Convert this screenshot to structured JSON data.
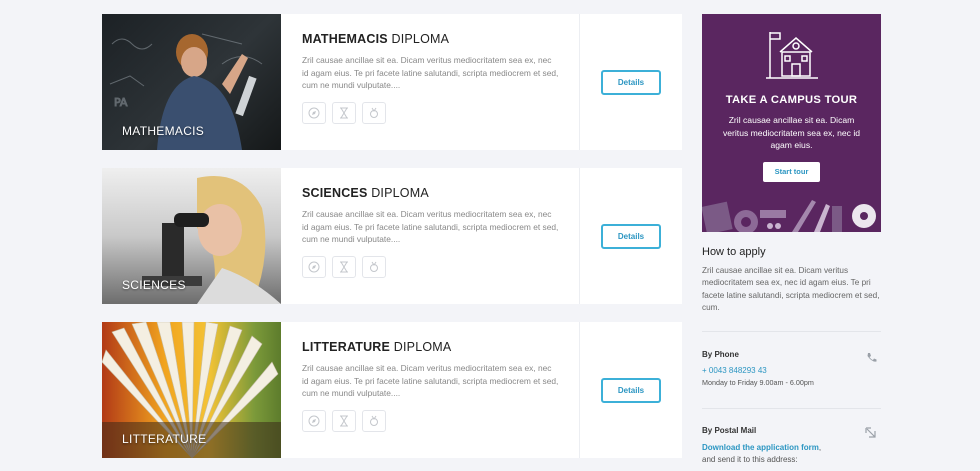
{
  "courses": [
    {
      "caption": "MATHEMACIS",
      "title_bold": "MATHEMACIS",
      "title_rest": "DIPLOMA",
      "description": "Zril causae ancillae sit ea. Dicam veritus mediocritatem sea ex, nec id agam eius. Te pri facete latine salutandi, scripta mediocrem et sed, cum ne mundi vulputate....",
      "button": "Details"
    },
    {
      "caption": "SCIENCES",
      "title_bold": "SCIENCES",
      "title_rest": "DIPLOMA",
      "description": "Zril causae ancillae sit ea. Dicam veritus mediocritatem sea ex, nec id agam eius. Te pri facete latine salutandi, scripta mediocrem et sed, cum ne mundi vulputate....",
      "button": "Details"
    },
    {
      "caption": "LITTERATURE",
      "title_bold": "LITTERATURE",
      "title_rest": "DIPLOMA",
      "description": "Zril causae ancillae sit ea. Dicam veritus mediocritatem sea ex, nec id agam eius. Te pri facete latine salutandi, scripta mediocrem et sed, cum ne mundi vulputate....",
      "button": "Details"
    }
  ],
  "feature_icons": [
    "compass-icon",
    "hourglass-icon",
    "medal-icon"
  ],
  "promo": {
    "title": "TAKE A CAMPUS TOUR",
    "text": "Zril causae ancillae sit ea. Dicam veritus mediocritatem sea ex, nec id agam eius.",
    "button": "Start tour",
    "background": "#5a2660"
  },
  "apply": {
    "title": "How to apply",
    "text": "Zril causae ancillae sit ea. Dicam veritus mediocritatem sea ex, nec id agam eius. Te pri facete latine salutandi, scripta mediocrem et sed, cum."
  },
  "phone": {
    "label": "By Phone",
    "number": "+ 0043 848293 43",
    "hours": "Monday to Friday 9.00am - 6.00pm"
  },
  "mail": {
    "label": "By Postal Mail",
    "link": "Download the application form",
    "after_link": ",",
    "text": "and send it to this address:"
  },
  "colors": {
    "accent": "#2c96c2",
    "button_border": "#3cb0d8",
    "page_bg": "#f3f4f8"
  }
}
